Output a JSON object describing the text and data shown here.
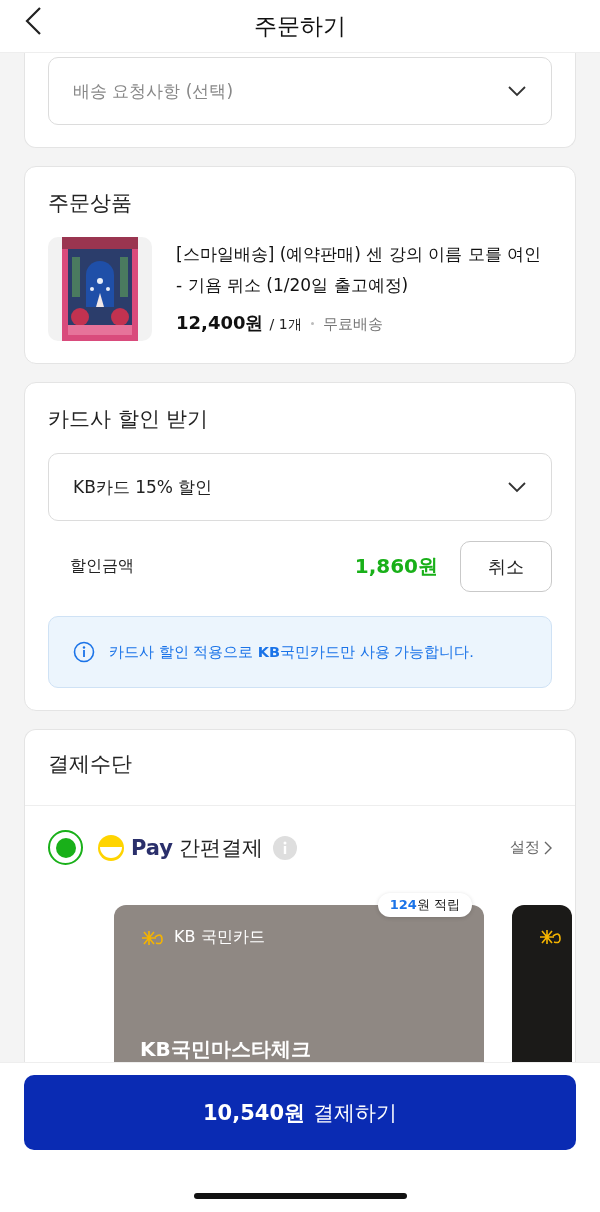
{
  "header": {
    "title": "주문하기"
  },
  "delivery_request": {
    "placeholder": "배송 요청사항 (선택)"
  },
  "order_items": {
    "title": "주문상품",
    "items": [
      {
        "name": "[스마일배송] (예약판매) 센 강의 이름 모를 여인 - 기욤 뮈소 (1/20일 출고예정)",
        "price": "12,400원",
        "quantity": "/ 1개",
        "shipping": "무료배송"
      }
    ]
  },
  "card_discount": {
    "title": "카드사 할인 받기",
    "selected_option": "KB카드 15% 할인",
    "amount_label": "할인금액",
    "amount": "1,860원",
    "cancel_button": "취소",
    "notice": "카드사 할인 적용으로 **KB**국민카드만 사용 가능합니다."
  },
  "payment": {
    "title": "결제수단",
    "methods": [
      {
        "brand": "Pay",
        "label": "간편결제",
        "selected": true,
        "settings_link": "설정"
      }
    ],
    "cards": [
      {
        "issuer": "KB 국민카드",
        "name": "KB국민마스타체크",
        "reward_amount": "124",
        "reward_label": "원 적립",
        "color": "#8f8883"
      },
      {
        "color": "#1b1a18"
      }
    ]
  },
  "checkout_button": {
    "amount": "10,540원",
    "label": "결제하기"
  }
}
